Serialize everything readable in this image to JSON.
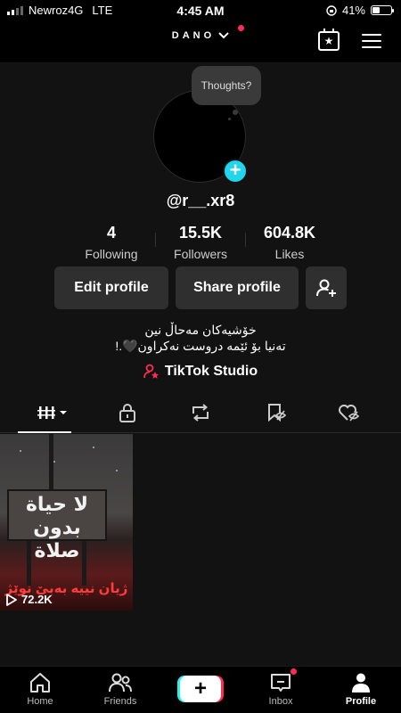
{
  "status_bar": {
    "carrier": "Newroz4G",
    "network": "LTE",
    "time": "4:45 AM",
    "battery": "41%",
    "battery_level": 0.41
  },
  "header": {
    "account_name": "DANO",
    "has_notification": true
  },
  "profile": {
    "thought_bubble": "Thoughts?",
    "username": "@r__.xr8",
    "stats": [
      {
        "value": "4",
        "label": "Following"
      },
      {
        "value": "15.5K",
        "label": "Followers"
      },
      {
        "value": "604.8K",
        "label": "Likes"
      }
    ],
    "buttons": {
      "edit": "Edit profile",
      "share": "Share profile"
    },
    "bio_line1": "خۆشیەکان مەحاڵ نین",
    "bio_line2": "تەنیا بۆ ئێمە دروست نەکراون🖤.!",
    "studio_link": "TikTok Studio"
  },
  "tabs": [
    "videos",
    "private",
    "reposts",
    "favorites",
    "liked"
  ],
  "videos": [
    {
      "sign_line1": "لا حياة",
      "sign_line2": "بدون صلاة",
      "caption": "ژیان نییە بەبێ نوێژ",
      "views": "72.2K"
    }
  ],
  "bottom_nav": [
    {
      "label": "Home"
    },
    {
      "label": "Friends"
    },
    {
      "label": "Inbox",
      "badge": true
    },
    {
      "label": "Profile",
      "active": true
    }
  ],
  "colors": {
    "accent_cyan": "#20d5ec",
    "accent_red": "#fe2c55",
    "background": "#121212"
  }
}
